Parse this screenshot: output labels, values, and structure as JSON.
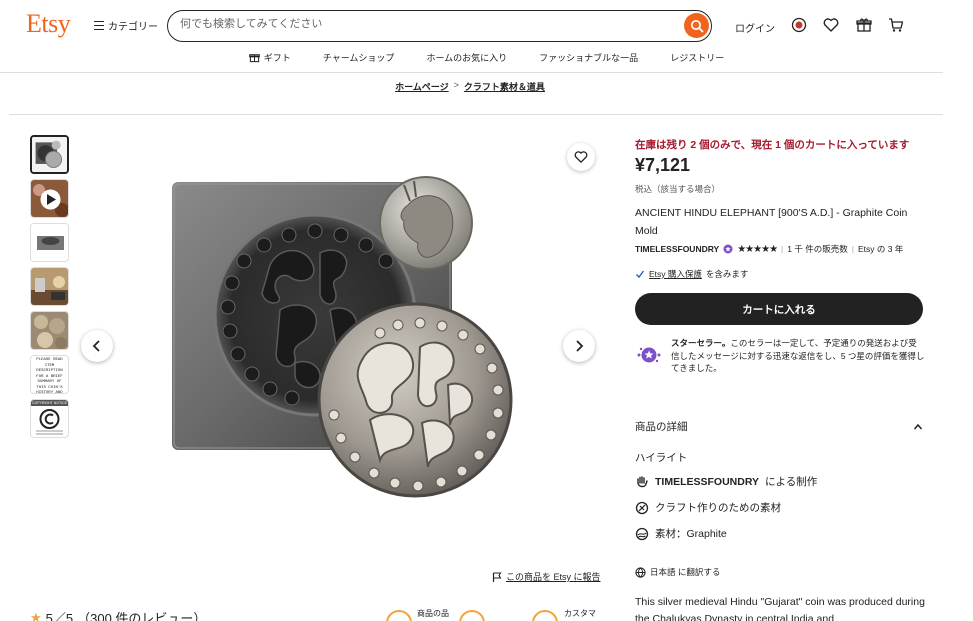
{
  "header": {
    "logo": "Etsy",
    "category_label": "カテゴリー",
    "search_placeholder": "何でも検索してみてください",
    "login_label": "ログイン"
  },
  "nav": {
    "items": [
      {
        "label": "ギフト"
      },
      {
        "label": "チャームショップ"
      },
      {
        "label": "ホームのお気に入り"
      },
      {
        "label": "ファッショナブルな一品"
      },
      {
        "label": "レジストリー"
      }
    ]
  },
  "breadcrumb": {
    "items": [
      "ホームページ",
      "クラフト素材＆道具"
    ],
    "separator": ">"
  },
  "gallery": {
    "thumb5_text": "PLEASE READ ITEM DESCRIPTION FOR A BRIEF SUMMARY OF THIS COIN'S HISTORY AND DIMENSIONS",
    "thumb6_text": "COPYRIGHT NOTICE",
    "report_label": "この商品を Etsy に報告"
  },
  "reviews": {
    "star": "★",
    "score": "5／5",
    "count": "（300 件のレビュー）"
  },
  "bottom_chips": {
    "chip1_label": "商品の品",
    "chip3_label": "カスタマ"
  },
  "product": {
    "stock_notice": "在庫は残り 2 個のみで、現在 1 個のカートに入っています",
    "price": "¥7,121",
    "tax_note": "税込（該当する場合）",
    "title": "ANCIENT HINDU ELEPHANT [900'S A.D.] - Graphite Coin Mold",
    "shop_name": "TIMELESSFOUNDRY",
    "stars": "★★★★★",
    "sales": "1 千 件の販売数",
    "years": "Etsy の 3 年",
    "protection_link": "Etsy 購入保護",
    "protection_suffix": "を含みます",
    "cart_button": "カートに入れる",
    "star_seller_bold": "スターセラー。",
    "star_seller_text": "このセラーは一定して、予定通りの発送および受信したメッセージに対する迅速な返信をし、5 つ星の評価を獲得してきました。",
    "details_heading": "商品の詳細",
    "highlights_heading": "ハイライト",
    "highlights": {
      "maker_shop": "TIMELESSFOUNDRY",
      "maker_suffix": "による制作",
      "craft": "クラフト作りのための素材",
      "material": "素材：Graphite"
    },
    "translate_label": "日本語 に翻訳する",
    "description": "This silver medieval Hindu \"Gujarat\" coin was produced during the Chalukyas Dynasty in central India and"
  },
  "colors": {
    "brand": "#f1641e",
    "stock_red": "#a61a2e",
    "button_dark": "#222222",
    "star_seller_purple": "#7f4ec9"
  }
}
